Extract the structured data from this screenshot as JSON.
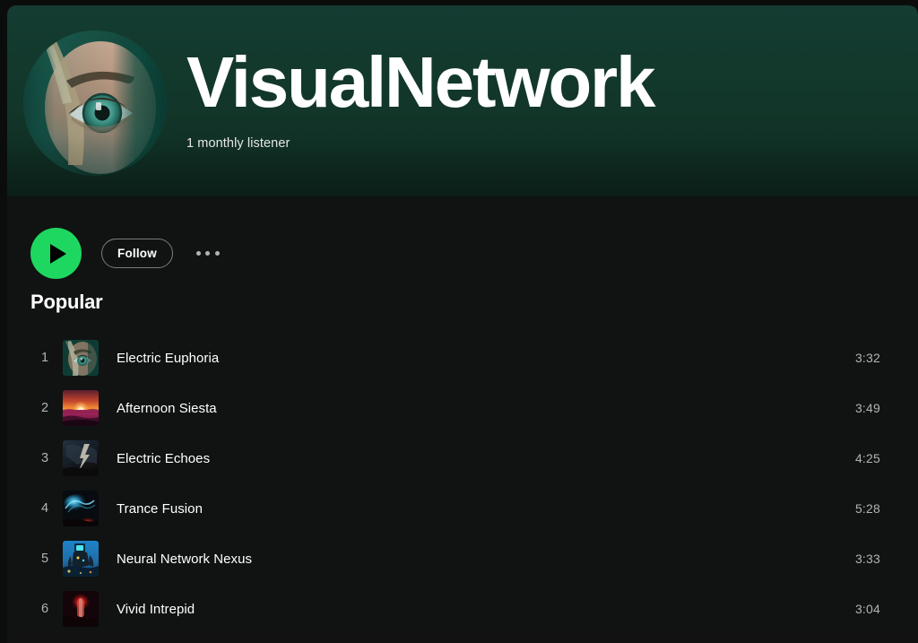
{
  "artist": {
    "name": "VisualNetwork",
    "monthly_listeners": "1 monthly listener",
    "avatar_alt": "artist-avatar-eye-photo",
    "header_color": "#143c32"
  },
  "actions": {
    "play_label": "play",
    "follow_label": "Follow",
    "more_label": "more options"
  },
  "popular": {
    "heading": "Popular",
    "tracks": [
      {
        "index": "1",
        "title": "Electric Euphoria",
        "duration": "3:32",
        "art": "eye"
      },
      {
        "index": "2",
        "title": "Afternoon Siesta",
        "duration": "3:49",
        "art": "sunset"
      },
      {
        "index": "3",
        "title": "Electric Echoes",
        "duration": "4:25",
        "art": "storm"
      },
      {
        "index": "4",
        "title": "Trance Fusion",
        "duration": "5:28",
        "art": "trance"
      },
      {
        "index": "5",
        "title": "Neural Network Nexus",
        "duration": "3:33",
        "art": "neural"
      },
      {
        "index": "6",
        "title": "Vivid Intrepid",
        "duration": "3:04",
        "art": "vivid"
      }
    ]
  },
  "theme": {
    "accent_green": "#1ed760",
    "background": "#101312",
    "text_primary": "#ffffff",
    "text_secondary": "#b3b3b3"
  }
}
